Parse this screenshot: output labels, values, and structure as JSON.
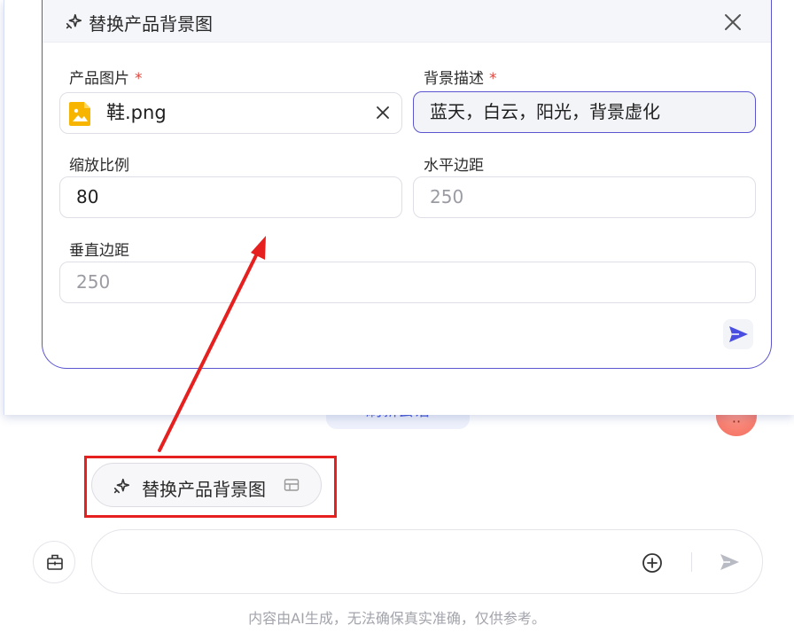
{
  "background": {
    "pill_text": "刷新会话",
    "avatar_text": "··"
  },
  "form": {
    "title": "替换产品背景图",
    "fields": {
      "product_image": {
        "label": "产品图片",
        "required_mark": "*",
        "file_name": "鞋.png"
      },
      "background_desc": {
        "label": "背景描述",
        "required_mark": "*",
        "value": "蓝天，白云，阳光，背景虚化"
      },
      "scale": {
        "label": "缩放比例",
        "value": "80"
      },
      "h_margin": {
        "label": "水平边距",
        "placeholder": "250"
      },
      "v_margin": {
        "label": "垂直边距",
        "placeholder": "250"
      }
    }
  },
  "skill_chip": {
    "label": "替换产品背景图"
  },
  "chat": {
    "input_value": "",
    "disclaimer": "内容由AI生成，无法确保真实准确，仅供参考。"
  },
  "colors": {
    "accent": "#5b55d0",
    "required": "#e0453a",
    "annotation": "#e6201f",
    "file_icon": "#f7b500"
  }
}
